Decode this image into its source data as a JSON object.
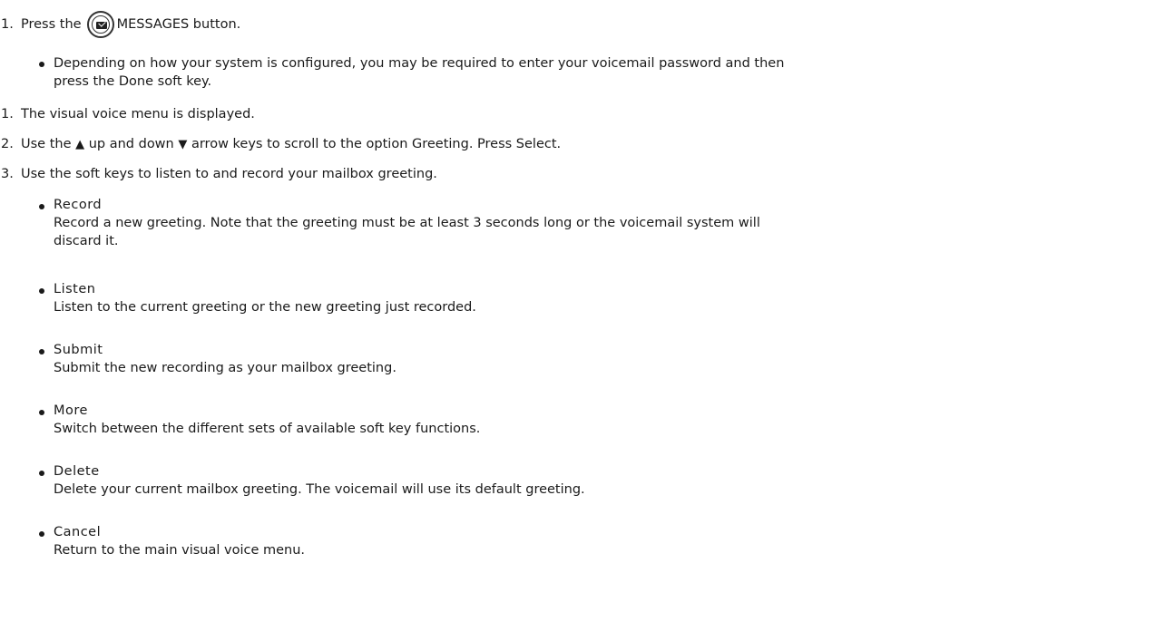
{
  "steps": {
    "s1": {
      "num": "1.",
      "pre": "Press the",
      "post": "MESSAGES button."
    },
    "b1": "Depending on how your system is configured, you may be required to enter your voicemail password and then",
    "b1_cont": "press the Done soft key.",
    "s2": {
      "num": "1.",
      "text": "The visual voice menu is displayed."
    },
    "s3": {
      "num": "2.",
      "a": "Use the",
      "up_arrow": "▲",
      "b": "up and down",
      "down_arrow": "▼",
      "c": "arrow keys to scroll to the option Greeting. Press Select."
    },
    "s4": {
      "num": "3.",
      "text": "Use the soft keys to listen to and record your mailbox greeting."
    }
  },
  "softkeys": [
    {
      "name": "Record",
      "desc1": "Record a new greeting. Note that the greeting must be at least 3 seconds long or the voicemail system will",
      "desc2": "discard it."
    },
    {
      "name": "Listen",
      "desc1": "Listen to the current greeting or the new greeting just recorded."
    },
    {
      "name": "Submit",
      "desc1": "Submit the new recording as your mailbox greeting."
    },
    {
      "name": "More",
      "desc1": "Switch between the different sets of available soft key functions."
    },
    {
      "name": "Delete",
      "desc1": "Delete your current mailbox greeting. The voicemail will use its default greeting."
    },
    {
      "name": "Cancel",
      "desc1": "Return to the main visual voice menu."
    }
  ],
  "icons": {
    "messages_button": "envelope-icon"
  }
}
